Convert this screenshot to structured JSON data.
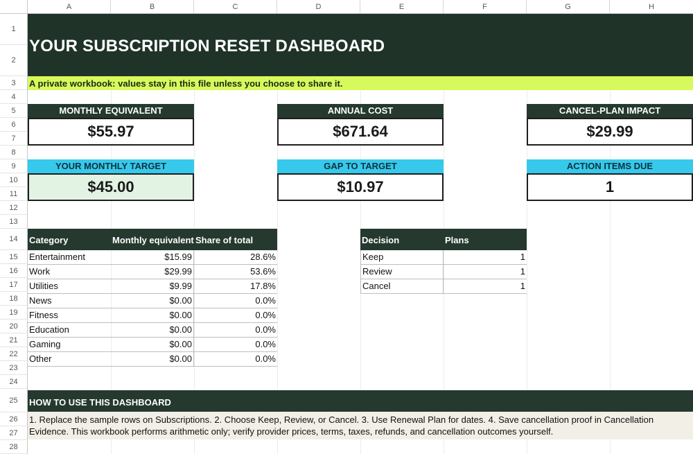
{
  "sheet": {
    "columns": [
      "A",
      "B",
      "C",
      "D",
      "E",
      "F",
      "G",
      "H"
    ],
    "rows": [
      "1",
      "2",
      "3",
      "4",
      "5",
      "6",
      "7",
      "8",
      "9",
      "10",
      "11",
      "12",
      "13",
      "14",
      "15",
      "16",
      "17",
      "18",
      "19",
      "20",
      "21",
      "22",
      "23",
      "24",
      "25",
      "26",
      "27",
      "28"
    ]
  },
  "header": {
    "title": "YOUR SUBSCRIPTION RESET DASHBOARD",
    "subtitle": "A private workbook: values stay in this file unless you choose to share it."
  },
  "cards": {
    "monthly_equivalent": {
      "label": "MONTHLY EQUIVALENT",
      "value": "$55.97"
    },
    "annual_cost": {
      "label": "ANNUAL COST",
      "value": "$671.64"
    },
    "cancel_plan_impact": {
      "label": "CANCEL-PLAN IMPACT",
      "value": "$29.99"
    },
    "monthly_target": {
      "label": "YOUR MONTHLY TARGET",
      "value": "$45.00"
    },
    "gap_to_target": {
      "label": "GAP TO TARGET",
      "value": "$10.97"
    },
    "action_items_due": {
      "label": "ACTION ITEMS DUE",
      "value": "1"
    }
  },
  "category_table": {
    "headers": [
      "Category",
      "Monthly equivalent",
      "Share of total"
    ],
    "rows": [
      {
        "category": "Entertainment",
        "monthly": "$15.99",
        "share": "28.6%"
      },
      {
        "category": "Work",
        "monthly": "$29.99",
        "share": "53.6%"
      },
      {
        "category": "Utilities",
        "monthly": "$9.99",
        "share": "17.8%"
      },
      {
        "category": "News",
        "monthly": "$0.00",
        "share": "0.0%"
      },
      {
        "category": "Fitness",
        "monthly": "$0.00",
        "share": "0.0%"
      },
      {
        "category": "Education",
        "monthly": "$0.00",
        "share": "0.0%"
      },
      {
        "category": "Gaming",
        "monthly": "$0.00",
        "share": "0.0%"
      },
      {
        "category": "Other",
        "monthly": "$0.00",
        "share": "0.0%"
      }
    ]
  },
  "decision_table": {
    "headers": [
      "Decision",
      "Plans"
    ],
    "rows": [
      {
        "decision": "Keep",
        "plans": "1"
      },
      {
        "decision": "Review",
        "plans": "1"
      },
      {
        "decision": "Cancel",
        "plans": "1"
      }
    ]
  },
  "howto": {
    "title": "HOW TO USE THIS DASHBOARD",
    "text": "1. Replace the sample rows on Subscriptions. 2. Choose Keep, Review, or Cancel. 3. Use Renewal Plan for dates. 4. Save cancellation proof in Cancellation Evidence. This workbook performs arithmetic only; verify provider prices, terms, taxes, refunds, and cancellation outcomes yourself."
  },
  "colors": {
    "dark_green": "#1f3329",
    "lime": "#d8f95c",
    "cyan": "#36c9ec",
    "target_fill": "#e2f3e3",
    "howto_fill": "#f1efe6"
  }
}
